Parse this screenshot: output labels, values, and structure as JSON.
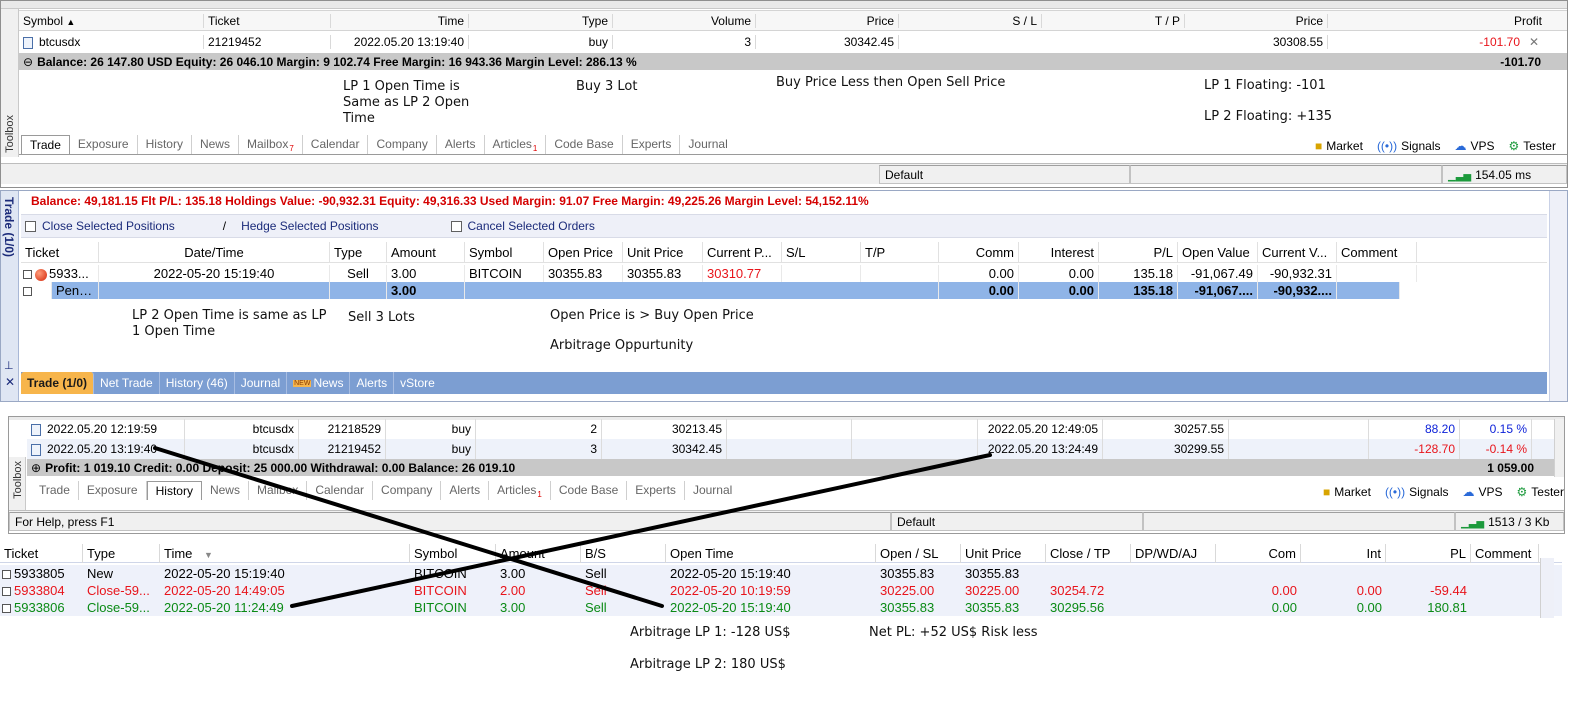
{
  "mt_top": {
    "columns": [
      "Symbol",
      "Ticket",
      "Time",
      "Type",
      "Volume",
      "Price",
      "S / L",
      "T / P",
      "Price",
      "Profit"
    ],
    "position": {
      "symbol": "btcusdx",
      "ticket": "21219452",
      "time": "2022.05.20 13:19:40",
      "type": "buy",
      "volume": "3",
      "price": "30342.45",
      "sl": "",
      "tp": "",
      "cur_price": "30308.55",
      "profit": "-101.70"
    },
    "balance_line": "Balance: 26 147.80 USD  Equity: 26 046.10  Margin: 9 102.74  Free Margin: 16 943.36  Margin Level: 286.13 %",
    "balance_profit": "-101.70",
    "notes": {
      "lp1_open_time": "LP 1 Open Time is Same as LP 2 Open Time",
      "buy_lot": "Buy 3 Lot",
      "buy_price": "Buy Price Less then Open Sell Price",
      "lp1_floating": "LP 1 Floating: -101",
      "lp2_floating": "LP 2 Floating: +135"
    },
    "tabs": [
      "Trade",
      "Exposure",
      "History",
      "News",
      "Mailbox",
      "Calendar",
      "Company",
      "Alerts",
      "Articles",
      "Code Base",
      "Experts",
      "Journal"
    ],
    "mailbox_badge": "7",
    "articles_badge": "1",
    "toolbox_label": "Toolbox",
    "right_tools": [
      "Market",
      "Signals",
      "VPS",
      "Tester"
    ],
    "status": {
      "profile": "Default",
      "ping": "154.05 ms"
    }
  },
  "lp2": {
    "side_label": "Trade (1/0)",
    "balance_line": "Balance: 49,181.15  Flt P/L: 135.18  Holdings Value: -90,932.31  Equity: 49,316.33  Used Margin: 91.07  Free Margin: 49,225.26  Margin Level: 54,152.11%",
    "actions": {
      "close": "Close Selected Positions",
      "slash": "/",
      "hedge": "Hedge Selected Positions",
      "cancel": "Cancel Selected Orders"
    },
    "columns": [
      "Ticket",
      "Date/Time",
      "Type",
      "Amount",
      "Symbol",
      "Open Price",
      "Unit Price",
      "Current P...",
      "S/L",
      "T/P",
      "Comm",
      "Interest",
      "P/L",
      "Open Value",
      "Current V...",
      "Comment"
    ],
    "row": {
      "ticket": "5933...",
      "datetime": "2022-05-20 15:19:40",
      "type": "Sell",
      "amount": "3.00",
      "symbol": "BITCOIN",
      "open_price": "30355.83",
      "unit_price": "30355.83",
      "current_price": "30310.77",
      "sl": "",
      "tp": "",
      "comm": "0.00",
      "interest": "0.00",
      "pl": "135.18",
      "open_value": "-91,067.49",
      "current_value": "-90,932.31",
      "comment": ""
    },
    "pending": {
      "label": "Pend...",
      "amount": "3.00",
      "comm": "0.00",
      "interest": "0.00",
      "pl": "135.18",
      "open_value": "-91,067....",
      "current_value": "-90,932...."
    },
    "notes": {
      "lp2_open_time": "LP 2 Open Time is same as LP 1 Open Time",
      "sell_lots": "Sell 3 Lots",
      "open_price": "Open Price is > Buy Open Price",
      "arbitrage": "Arbitrage Oppurtunity"
    },
    "tabs": [
      "Trade (1/0)",
      "Net Trade",
      "History (46)",
      "Journal",
      "News",
      "Alerts",
      "vStore"
    ],
    "news_badge": "NEW"
  },
  "mt_history": {
    "rows": [
      {
        "open_time": "2022.05.20 12:19:59",
        "symbol": "btcusdx",
        "ticket": "21218529",
        "type": "buy",
        "volume": "2",
        "price": "30213.45",
        "close_time": "2022.05.20 12:49:05",
        "close_price": "30257.55",
        "profit": "88.20",
        "pct": "0.15 %"
      },
      {
        "open_time": "2022.05.20 13:19:40",
        "symbol": "btcusdx",
        "ticket": "21219452",
        "type": "buy",
        "volume": "3",
        "price": "30342.45",
        "close_time": "2022.05.20 13:24:49",
        "close_price": "30299.55",
        "profit": "-128.70",
        "pct": "-0.14 %"
      }
    ],
    "summary": "Profit: 1 019.10  Credit: 0.00  Deposit: 25 000.00  Withdrawal: 0.00  Balance: 26 019.10",
    "summary_total": "1 059.00",
    "tabs": [
      "Trade",
      "Exposure",
      "History",
      "News",
      "Mailbox",
      "Calendar",
      "Company",
      "Alerts",
      "Articles",
      "Code Base",
      "Experts",
      "Journal"
    ],
    "articles_badge": "1",
    "toolbox_label": "Toolbox",
    "right_tools": [
      "Market",
      "Signals",
      "VPS",
      "Tester"
    ],
    "status": {
      "help": "For Help, press F1",
      "profile": "Default",
      "traffic": "1513 / 3 Kb"
    }
  },
  "lp2_history": {
    "columns": [
      "Ticket",
      "Type",
      "Time",
      "Symbol",
      "Amount",
      "B/S",
      "Open Time",
      "Open / SL",
      "Unit Price",
      "Close / TP",
      "DP/WD/AJ",
      "Com",
      "Int",
      "PL",
      "Comment"
    ],
    "rows": [
      {
        "ticket": "5933805",
        "type": "New",
        "time": "2022-05-20 15:19:40",
        "symbol": "BITCOIN",
        "amount": "3.00",
        "bs": "Sell",
        "open_time": "2022-05-20 15:19:40",
        "open_sl": "30355.83",
        "unit_price": "30355.83",
        "close_tp": "",
        "dp": "",
        "com": "",
        "int": "",
        "pl": "",
        "comment": ""
      },
      {
        "ticket": "5933804",
        "type": "Close-59...",
        "time": "2022-05-20 14:49:05",
        "symbol": "BITCOIN",
        "amount": "2.00",
        "bs": "Sell",
        "open_time": "2022-05-20 10:19:59",
        "open_sl": "30225.00",
        "unit_price": "30225.00",
        "close_tp": "30254.72",
        "dp": "",
        "com": "0.00",
        "int": "0.00",
        "pl": "-59.44",
        "comment": ""
      },
      {
        "ticket": "5933806",
        "type": "Close-59...",
        "time": "2022-05-20 11:24:49",
        "symbol": "BITCOIN",
        "amount": "3.00",
        "bs": "Sell",
        "open_time": "2022-05-20 15:19:40",
        "open_sl": "30355.83",
        "unit_price": "30355.83",
        "close_tp": "30295.56",
        "dp": "",
        "com": "0.00",
        "int": "0.00",
        "pl": "180.81",
        "comment": ""
      }
    ]
  },
  "summary_notes": {
    "arb_lp1": "Arbitrage LP 1: -128 US$",
    "net_pl": "Net PL: +52 US$ Risk less",
    "arb_lp2": "Arbitrage LP 2: 180 US$"
  },
  "colors": {
    "loss": "#e8141b",
    "gain": "#0a8a15",
    "profit_blue": "#0a1fd8",
    "lp2_tab_bar": "#7c9ed2",
    "lp2_active_tab": "#f7b54b",
    "balance_bar": "#c8c8c8"
  }
}
